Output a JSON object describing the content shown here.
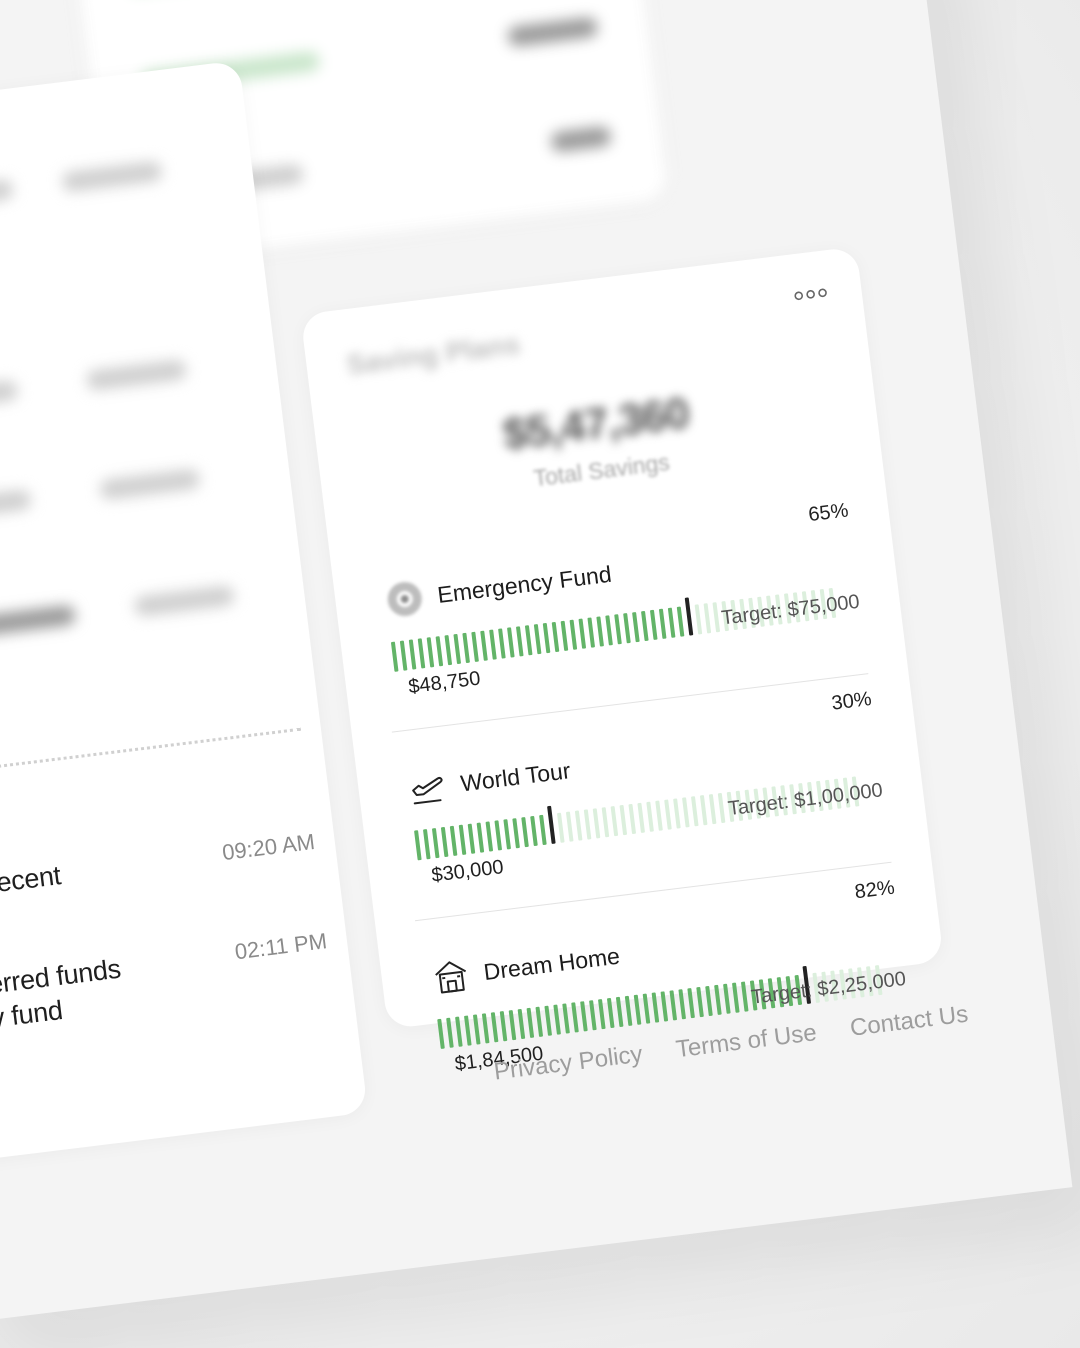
{
  "activity": [
    {
      "text": "ewed recent\nns",
      "time": "09:20 AM"
    },
    {
      "text": "ransferred funds\ngency fund",
      "time": "02:11 PM"
    }
  ],
  "savings": {
    "menu_icon": "more-horizontal-icon",
    "title": "Saving Plans",
    "total": "$5,47,360",
    "total_label": "Total Savings",
    "goals": [
      {
        "name": "Emergency Fund",
        "icon": "life-buoy-icon",
        "percent_label": "65%",
        "progress": 0.65,
        "target": "Target: $75,000",
        "saved": "$48,750"
      },
      {
        "name": "World Tour",
        "icon": "airplane-takeoff-icon",
        "percent_label": "30%",
        "progress": 0.3,
        "target": "Target: $1,00,000",
        "saved": "$30,000"
      },
      {
        "name": "Dream Home",
        "icon": "house-icon",
        "percent_label": "82%",
        "progress": 0.82,
        "target": "Target: $2,25,000",
        "saved": "$1,84,500"
      }
    ]
  },
  "footer": {
    "privacy": "Privacy Policy",
    "terms": "Terms of Use",
    "contact": "Contact Us"
  },
  "colors": {
    "accent_green": "#63b468",
    "track_green": "#dcefdd",
    "marker": "#222222"
  }
}
